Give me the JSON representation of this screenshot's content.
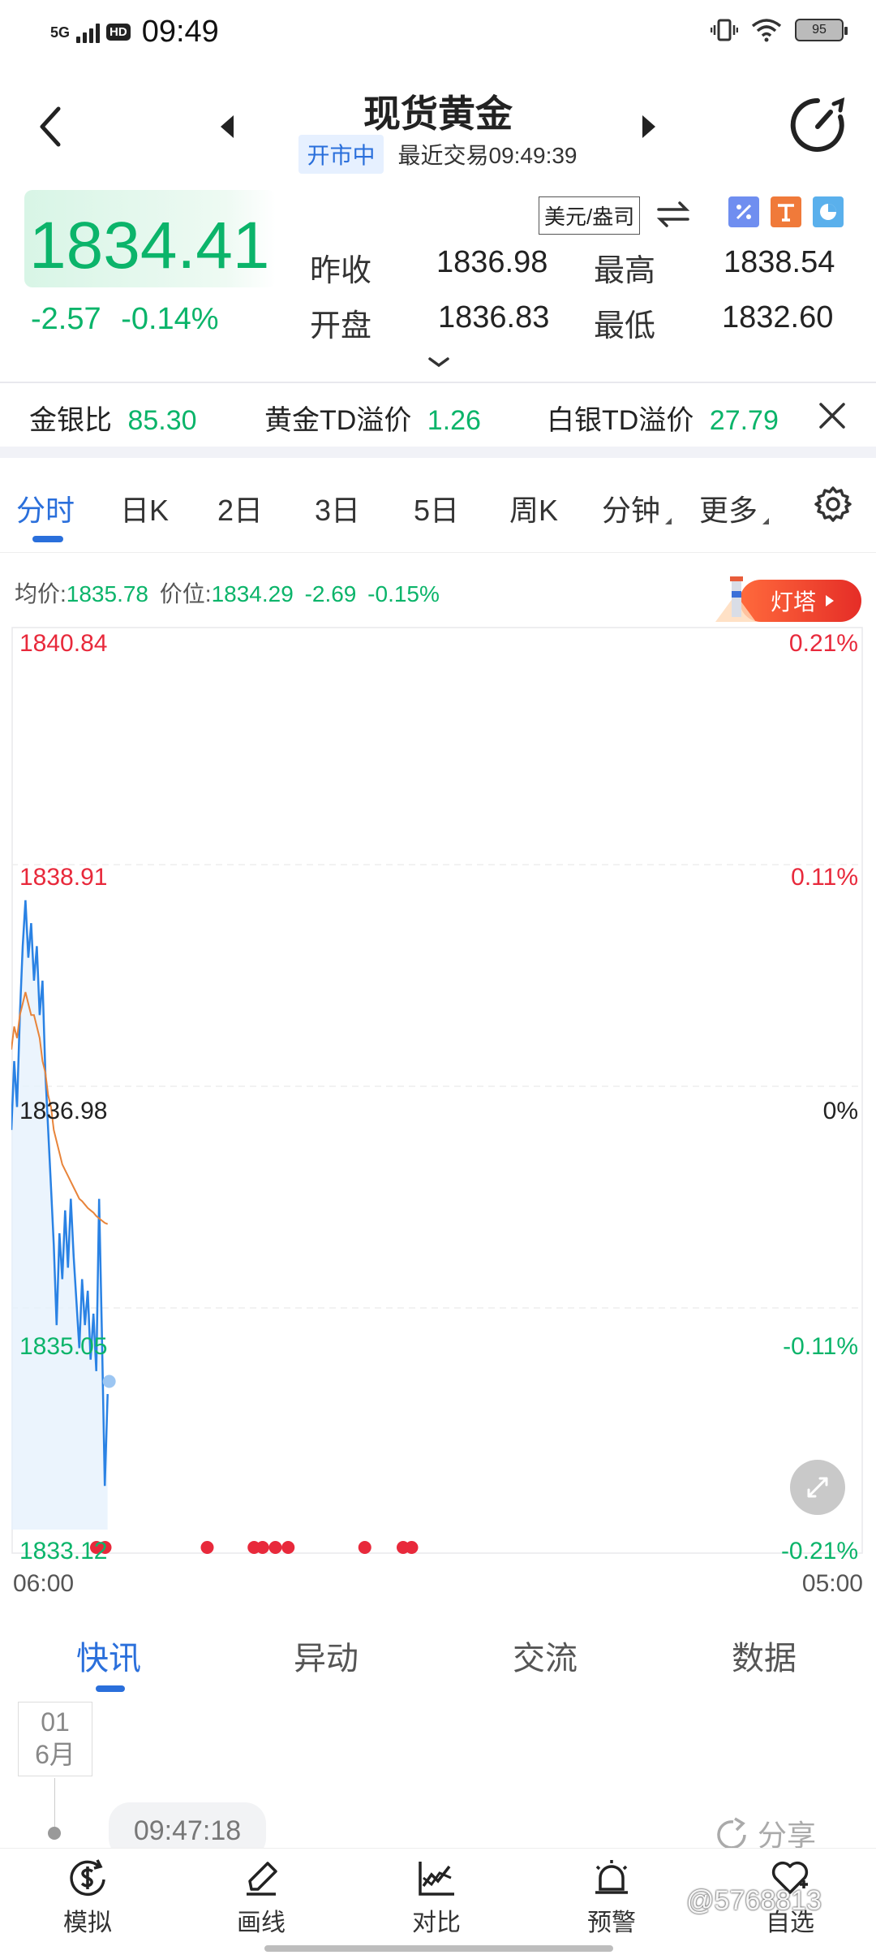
{
  "status_bar": {
    "network": "5G",
    "hd": "HD",
    "time": "09:49",
    "battery": "95"
  },
  "header": {
    "title": "现货黄金",
    "market_status": "开市中",
    "last_trade": "最近交易09:49:39"
  },
  "quote": {
    "price": "1834.41",
    "change": "-2.57",
    "change_pct": "-0.14%",
    "unit": "美元/盎司",
    "prev_close_label": "昨收",
    "prev_close": "1836.98",
    "high_label": "最高",
    "high": "1838.54",
    "open_label": "开盘",
    "open": "1836.83",
    "low_label": "最低",
    "low": "1832.60"
  },
  "ratios": {
    "gold_silver_label": "金银比",
    "gold_silver": "85.30",
    "gold_td_label": "黄金TD溢价",
    "gold_td": "1.26",
    "silver_td_label": "白银TD溢价",
    "silver_td": "27.79"
  },
  "tabs": {
    "items": [
      "分时",
      "日K",
      "2日",
      "3日",
      "5日",
      "周K",
      "分钟",
      "更多"
    ],
    "active": "分时"
  },
  "info_line": {
    "avg_label": "均价:",
    "avg": "1835.78",
    "price_label": "价位:",
    "price": "1834.29",
    "change": "-2.69",
    "change_pct": "-0.15%",
    "lighthouse": "灯塔"
  },
  "chart_data": {
    "type": "line",
    "y_ticks": [
      "1840.84",
      "1838.91",
      "1836.98",
      "1835.05",
      "1833.12"
    ],
    "pct_ticks": [
      "0.21%",
      "0.11%",
      "0%",
      "-0.11%",
      "-0.21%"
    ],
    "x_ticks": [
      "06:00",
      "05:00"
    ],
    "ylim": [
      1833.12,
      1840.84
    ],
    "baseline": 1836.98,
    "session_fraction_elapsed": 0.113,
    "series": [
      {
        "line_color": "#2a82e4",
        "values": [
          1836.6,
          1837.2,
          1836.8,
          1837.6,
          1838.2,
          1838.6,
          1838.1,
          1838.4,
          1837.9,
          1838.2,
          1837.6,
          1837.9,
          1837.1,
          1836.6,
          1836.1,
          1835.6,
          1834.9,
          1835.7,
          1835.3,
          1835.9,
          1835.4,
          1836.0,
          1835.5,
          1835.1,
          1834.7,
          1835.3,
          1834.9,
          1835.2,
          1834.6,
          1835.0,
          1834.5,
          1836.0,
          1834.8,
          1833.5,
          1834.3
        ]
      },
      {
        "line_color": "#e8843a",
        "values": [
          1837.3,
          1837.5,
          1837.4,
          1837.6,
          1837.7,
          1837.8,
          1837.7,
          1837.6,
          1837.6,
          1837.5,
          1837.4,
          1837.2,
          1837.1,
          1836.9,
          1836.8,
          1836.6,
          1836.5,
          1836.4,
          1836.3,
          1836.25,
          1836.2,
          1836.15,
          1836.1,
          1836.05,
          1836.0,
          1835.98,
          1835.95,
          1835.92,
          1835.9,
          1835.88,
          1835.85,
          1835.83,
          1835.81,
          1835.79,
          1835.78
        ]
      }
    ],
    "event_marker_fractions": [
      0.1,
      0.11,
      0.23,
      0.285,
      0.295,
      0.31,
      0.325,
      0.415,
      0.46,
      0.47
    ],
    "event_color": "#e8293b",
    "up_color": "#e8293b",
    "down_color": "#0bb46a"
  },
  "news_tabs": {
    "items": [
      "快讯",
      "异动",
      "交流",
      "数据"
    ],
    "active": "快讯"
  },
  "news": {
    "day": "01",
    "month": "6月",
    "time": "09:47:18",
    "share": "分享"
  },
  "bottom_nav": {
    "items": [
      "模拟",
      "画线",
      "对比",
      "预警",
      "自选"
    ]
  },
  "watermark": "@5768813",
  "colors": {
    "accent": "#2a6fdb",
    "green": "#0bb46a",
    "red": "#e8293b"
  }
}
